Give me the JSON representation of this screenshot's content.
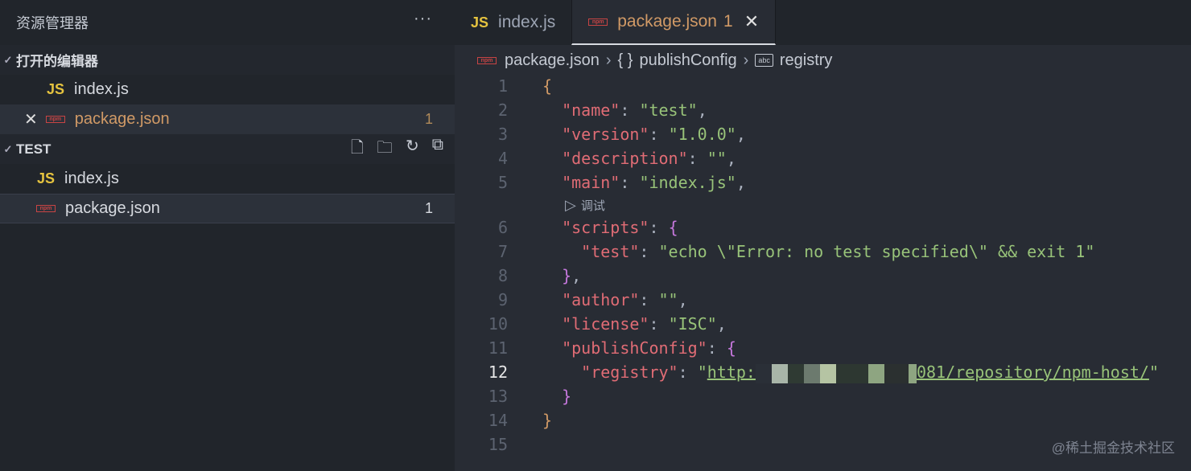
{
  "sidebar": {
    "title": "资源管理器",
    "more": "···",
    "open_editors": {
      "label": "打开的编辑器",
      "items": [
        {
          "icon": "JS",
          "name": "index.js"
        },
        {
          "icon": "npm",
          "name": "package.json",
          "badge": "1"
        }
      ]
    },
    "project": {
      "label": "TEST",
      "items": [
        {
          "icon": "JS",
          "name": "index.js"
        },
        {
          "icon": "npm",
          "name": "package.json",
          "badge": "1"
        }
      ]
    }
  },
  "tabs": [
    {
      "icon": "JS",
      "label": "index.js"
    },
    {
      "icon": "npm",
      "label": "package.json",
      "badge": "1",
      "close": "✕"
    }
  ],
  "breadcrumb": {
    "file": "package.json",
    "obj_icon": "{ }",
    "obj": "publishConfig",
    "str_icon": "abc",
    "prop": "registry"
  },
  "codelens": "调试",
  "lines": [
    {
      "n": "1",
      "t": [
        [
          "o",
          "{"
        ]
      ]
    },
    {
      "n": "2",
      "t": [
        [
          "p",
          "  "
        ],
        [
          "k",
          "\"name\""
        ],
        [
          "p",
          ": "
        ],
        [
          "s",
          "\"test\""
        ],
        [
          "p",
          ","
        ]
      ]
    },
    {
      "n": "3",
      "t": [
        [
          "p",
          "  "
        ],
        [
          "k",
          "\"version\""
        ],
        [
          "p",
          ": "
        ],
        [
          "s",
          "\"1.0.0\""
        ],
        [
          "p",
          ","
        ]
      ]
    },
    {
      "n": "4",
      "t": [
        [
          "p",
          "  "
        ],
        [
          "k",
          "\"description\""
        ],
        [
          "p",
          ": "
        ],
        [
          "s",
          "\"\""
        ],
        [
          "p",
          ","
        ]
      ]
    },
    {
      "n": "5",
      "t": [
        [
          "p",
          "  "
        ],
        [
          "k",
          "\"main\""
        ],
        [
          "p",
          ": "
        ],
        [
          "s",
          "\"index.js\""
        ],
        [
          "p",
          ","
        ]
      ]
    },
    {
      "n": "6",
      "t": [
        [
          "p",
          "  "
        ],
        [
          "k",
          "\"scripts\""
        ],
        [
          "p",
          ": "
        ],
        [
          "b",
          "{"
        ]
      ]
    },
    {
      "n": "7",
      "t": [
        [
          "p",
          "    "
        ],
        [
          "k",
          "\"test\""
        ],
        [
          "p",
          ": "
        ],
        [
          "s",
          "\"echo \\\"Error: no test specified\\\" && exit 1\""
        ]
      ]
    },
    {
      "n": "8",
      "t": [
        [
          "p",
          "  "
        ],
        [
          "b",
          "}"
        ],
        [
          "p",
          ","
        ]
      ]
    },
    {
      "n": "9",
      "t": [
        [
          "p",
          "  "
        ],
        [
          "k",
          "\"author\""
        ],
        [
          "p",
          ": "
        ],
        [
          "s",
          "\"\""
        ],
        [
          "p",
          ","
        ]
      ]
    },
    {
      "n": "10",
      "t": [
        [
          "p",
          "  "
        ],
        [
          "k",
          "\"license\""
        ],
        [
          "p",
          ": "
        ],
        [
          "s",
          "\"ISC\""
        ],
        [
          "p",
          ","
        ]
      ]
    },
    {
      "n": "11",
      "t": [
        [
          "p",
          "  "
        ],
        [
          "k",
          "\"publishConfig\""
        ],
        [
          "p",
          ": "
        ],
        [
          "b",
          "{"
        ]
      ]
    },
    {
      "n": "12",
      "cur": true,
      "t": [
        [
          "p",
          "    "
        ],
        [
          "k",
          "\"registry\""
        ],
        [
          "p",
          ": "
        ],
        [
          "s",
          "\""
        ],
        [
          "u",
          "http:"
        ],
        [
          "blur",
          ""
        ],
        [
          "u",
          "081/repository/npm-host/"
        ],
        [
          "s",
          "\""
        ]
      ]
    },
    {
      "n": "13",
      "t": [
        [
          "p",
          "  "
        ],
        [
          "b",
          "}"
        ]
      ]
    },
    {
      "n": "14",
      "t": [
        [
          "o",
          "}"
        ]
      ]
    },
    {
      "n": "15",
      "t": []
    }
  ],
  "watermark": "@稀土掘金技术社区"
}
